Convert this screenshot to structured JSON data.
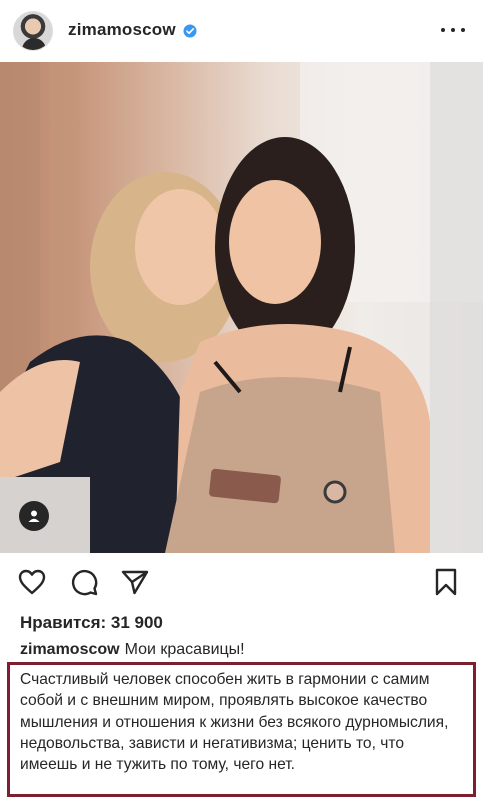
{
  "post": {
    "username": "zimamoscow",
    "verified": true,
    "likes_label": "Нравится:",
    "likes_count": "31 900",
    "caption_username": "zimamoscow",
    "caption_title": "Мои красавицы!",
    "caption_body": "Счастливый человек способен жить в гармонии с самим собой и с внешним миром, проявлять высокое качество мышления и отношения к жизни без всякого дурномыслия, недовольства, зависти и негативизма; ценить то, что имеешь и не тужить по тому, чего нет."
  },
  "icons": {
    "header": [
      "verified-badge-icon",
      "more-options-icon"
    ],
    "actions": [
      "heart-icon",
      "comment-icon",
      "share-icon",
      "bookmark-icon"
    ],
    "photo": [
      "user-tag-icon"
    ]
  },
  "colors": {
    "verified": "#3897f0",
    "highlight_border": "#7d1f2e",
    "text": "#262626"
  }
}
